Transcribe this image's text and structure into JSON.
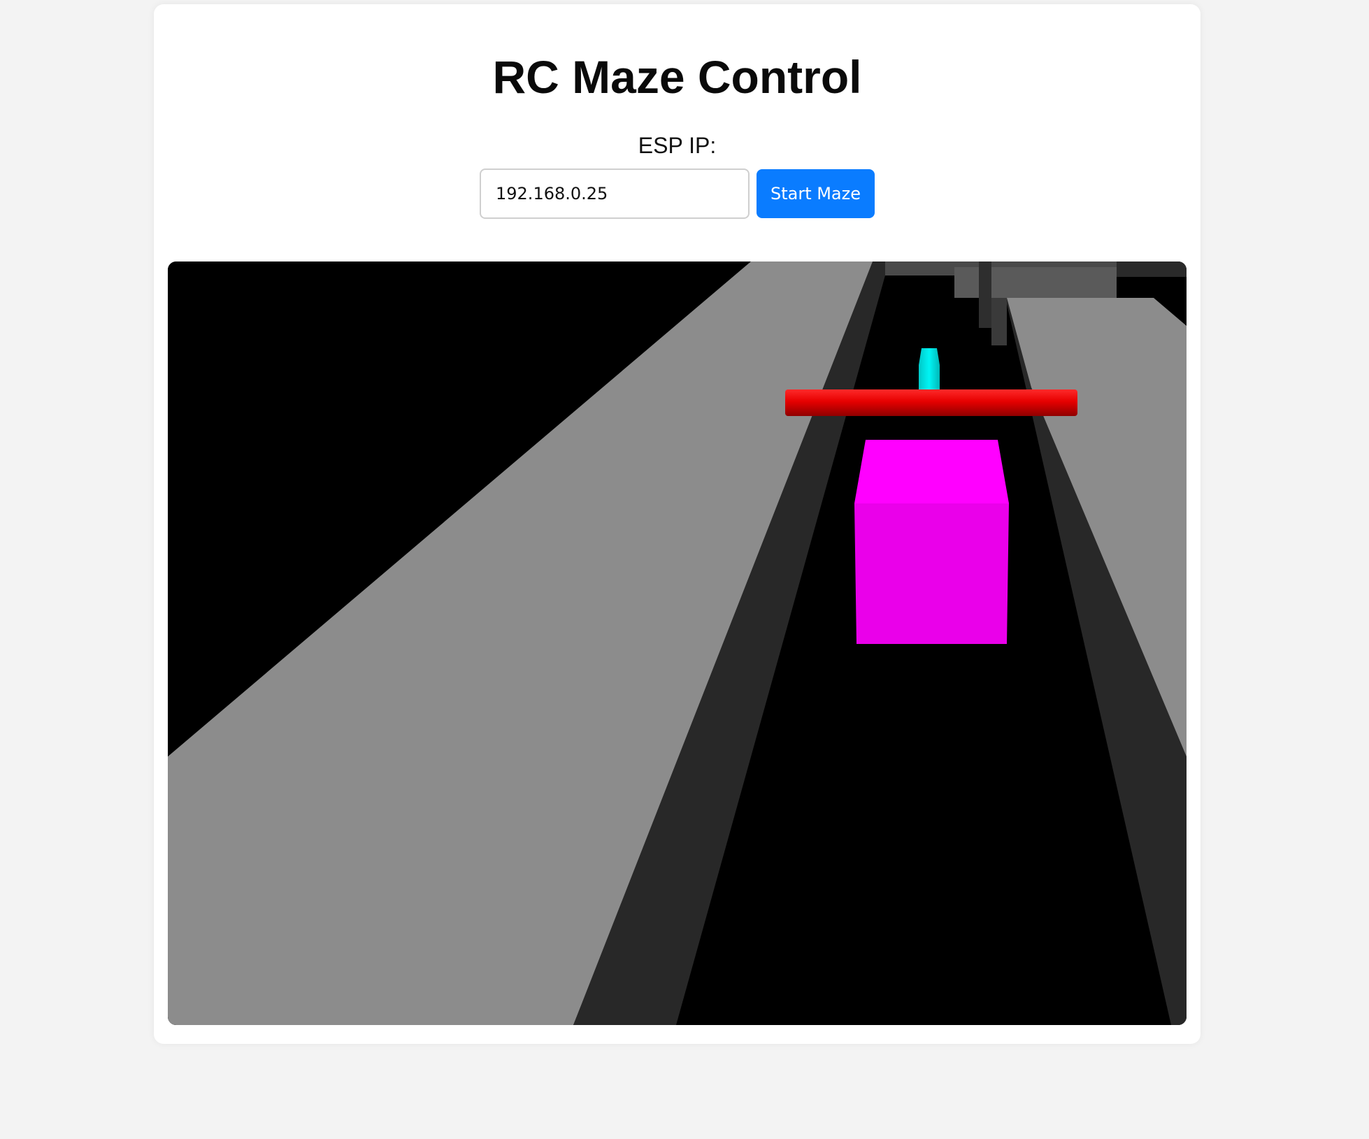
{
  "page": {
    "title": "RC Maze Control"
  },
  "connection": {
    "ip_label": "ESP IP:",
    "ip_value": "192.168.0.25",
    "start_button_label": "Start Maze"
  },
  "scene": {
    "background_color": "#000000",
    "floor_color": "#8c8c8c",
    "wall_shadow_color": "#282828",
    "block_color": "#ee00ee",
    "beam_color": "#e60000",
    "marker_color": "#00e6e6"
  }
}
